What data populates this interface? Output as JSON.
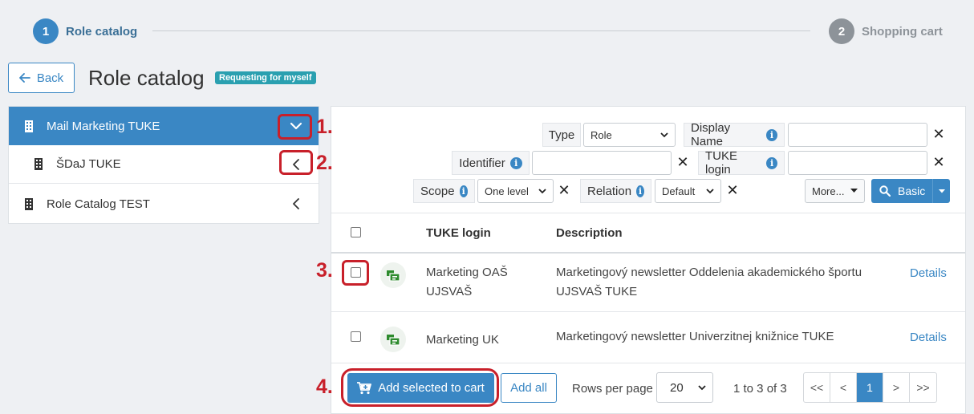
{
  "wizard": {
    "step1": {
      "number": "1",
      "label": "Role catalog"
    },
    "step2": {
      "number": "2",
      "label": "Shopping cart"
    }
  },
  "header": {
    "back_label": "Back",
    "title": "Role catalog",
    "badge": "Requesting for myself"
  },
  "tree": {
    "items": [
      {
        "label": "Mail Marketing TUKE"
      },
      {
        "label": "ŠDaJ TUKE"
      },
      {
        "label": "Role Catalog TEST"
      }
    ]
  },
  "filters": {
    "type_label": "Type",
    "type_value": "Role",
    "display_name_label": "Display Name",
    "display_name_value": "",
    "identifier_label": "Identifier",
    "identifier_value": "",
    "tuke_login_label": "TUKE login",
    "tuke_login_value": "",
    "scope_label": "Scope",
    "scope_value": "One level",
    "relation_label": "Relation",
    "relation_value": "Default",
    "more_label": "More...",
    "basic_label": "Basic",
    "clear_symbol": "✕"
  },
  "table": {
    "columns": [
      "TUKE login",
      "Description"
    ],
    "rows": [
      {
        "login_line1": "Marketing OAŠ",
        "login_line2": "UJSVAŠ",
        "desc_line1": "Marketingový newsletter Oddelenia akademického športu",
        "desc_line2": "UJSVAŠ TUKE",
        "details": "Details"
      },
      {
        "login_line1": "Marketing UK",
        "desc_line1": "Marketingový newsletter Univerzitnej knižnice TUKE",
        "details": "Details"
      }
    ]
  },
  "footer": {
    "add_selected": "Add selected to cart",
    "add_all": "Add all",
    "rows_per_page_label": "Rows per page",
    "rows_per_page_value": "20",
    "range": "1 to 3 of 3",
    "pager": {
      "first": "<<",
      "prev": "<",
      "current": "1",
      "next": ">",
      "last": ">>"
    }
  },
  "annotations": [
    "1.",
    "2.",
    "3.",
    "4."
  ],
  "colors": {
    "accent": "#3a87c4",
    "annotation": "#c8202a",
    "badge": "#2aa0b0"
  },
  "icons": [
    "arrow-left-icon",
    "building-icon",
    "chevron-down-icon",
    "chevron-left-icon",
    "info-icon",
    "search-icon",
    "caret-down-icon",
    "role-icon",
    "cart-icon"
  ]
}
